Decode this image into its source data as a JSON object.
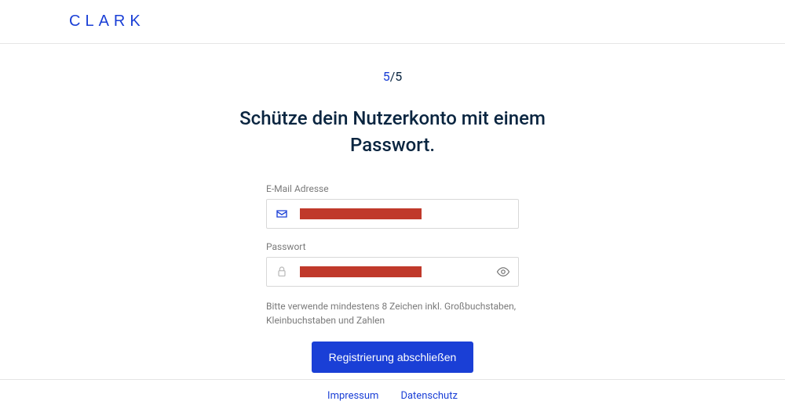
{
  "brand": "CLARK",
  "step": {
    "current": "5",
    "separator": "/",
    "total": "5"
  },
  "title": "Schütze dein Nutzerkonto mit einem Passwort.",
  "form": {
    "email": {
      "label": "E-Mail Adresse"
    },
    "password": {
      "label": "Passwort"
    },
    "hint": "Bitte verwende mindestens 8 Zeichen inkl. Großbuchstaben, Kleinbuchstaben und Zahlen",
    "submit_label": "Registrierung abschließen"
  },
  "footer": {
    "imprint": "Impressum",
    "privacy": "Datenschutz"
  }
}
